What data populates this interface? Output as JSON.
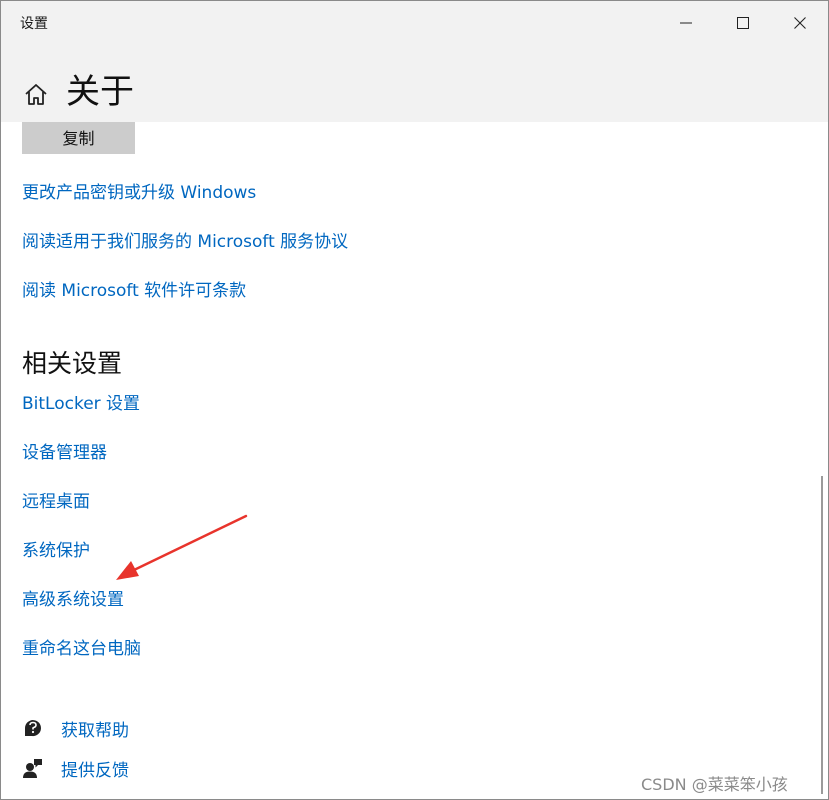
{
  "window": {
    "title": "设置",
    "controls": {
      "minimize_icon": "minimize-icon",
      "maximize_icon": "maximize-icon",
      "close_icon": "close-icon"
    }
  },
  "header": {
    "home_icon": "home-icon",
    "title": "关于"
  },
  "main": {
    "copy_button": "复制",
    "links": [
      "更改产品密钥或升级 Windows",
      "阅读适用于我们服务的 Microsoft 服务协议",
      "阅读 Microsoft 软件许可条款"
    ],
    "related_settings": {
      "title": "相关设置",
      "items": [
        "BitLocker 设置",
        "设备管理器",
        "远程桌面",
        "系统保护",
        "高级系统设置",
        "重命名这台电脑"
      ]
    },
    "help": [
      {
        "label": "获取帮助",
        "icon": "get-help-icon"
      },
      {
        "label": "提供反馈",
        "icon": "feedback-icon"
      }
    ]
  },
  "annotation": {
    "arrow_color": "#e8342c",
    "points_to": "高级系统设置"
  },
  "watermark": "CSDN @菜菜笨小孩",
  "colors": {
    "link": "#0067c0",
    "header_bg": "#f2f2f2",
    "button_bg": "#cccccc"
  }
}
